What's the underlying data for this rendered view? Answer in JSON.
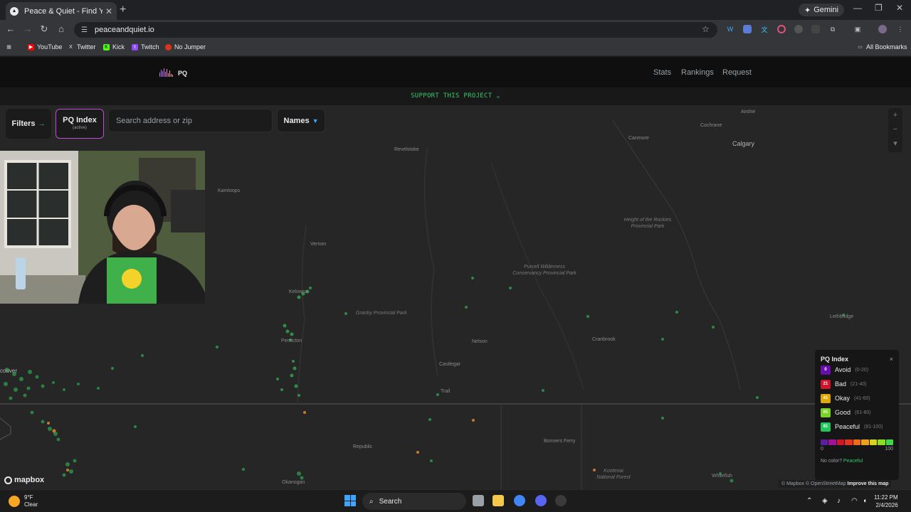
{
  "browser": {
    "tab_title": "Peace & Quiet - Find Your Quie",
    "url": "peaceandquiet.io",
    "gemini_label": "Gemini",
    "bookmarks": [
      "YouTube",
      "Twitter",
      "Kick",
      "Twitch",
      "No Jumper"
    ],
    "all_bookmarks": "All Bookmarks"
  },
  "site": {
    "logo_text": "PQ",
    "nav": [
      "Stats",
      "Rankings",
      "Request"
    ],
    "support_banner": "SUPPORT THIS PROJECT ⌄"
  },
  "controls": {
    "filters_label": "Filters",
    "pq_index_label": "PQ Index",
    "pq_index_sub": "(active)",
    "search_placeholder": "Search address or zip",
    "names_label": "Names"
  },
  "map_labels": {
    "revelstoke": "Revelstoke",
    "kamloops": "Kamloops",
    "vernon": "Vernon",
    "kelowna": "Kelowna",
    "penticton": "Penticton",
    "nelson": "Nelson",
    "castlegar": "Castlegar",
    "trail": "Trail",
    "cranbrook": "Cranbrook",
    "calgary": "Calgary",
    "airdrie": "Airdrie",
    "cochrane": "Cochrane",
    "canmore": "Canmore",
    "lethbridge": "Lethbridge",
    "granby": "Granby Provincial Park",
    "purcell": "Purcell Wilderness Conservancy Provincial Park",
    "height_rockies": "Height of the Rockies Provincial Park",
    "republic": "Republic",
    "bonners_ferry": "Bonners Ferry",
    "kootenai": "Kootenai National Forest",
    "okanogan": "Okanogan",
    "whitefish": "Whitefish",
    "vancouver": "couver"
  },
  "legend": {
    "title": "PQ Index",
    "close": "×",
    "items": [
      {
        "score": "0",
        "name": "Avoid",
        "range": "(0-20)",
        "color": "#6a0dad"
      },
      {
        "score": "21",
        "name": "Bad",
        "range": "(21-40)",
        "color": "#d0142c"
      },
      {
        "score": "41",
        "name": "Okay",
        "range": "(41-60)",
        "color": "#e0a800"
      },
      {
        "score": "61",
        "name": "Good",
        "range": "(61-80)",
        "color": "#7bd321"
      },
      {
        "score": "81",
        "name": "Peaceful",
        "range": "(81-100)",
        "color": "#22c55e"
      }
    ],
    "scale_min": "0",
    "scale_max": "100",
    "gradient": [
      "#5b1fa0",
      "#a1129a",
      "#d0142c",
      "#e0351f",
      "#ee6a16",
      "#eca31a",
      "#d6d320",
      "#8bdc24",
      "#3fd64a"
    ],
    "no_color_label": "No color?",
    "no_color_value": "Peaceful"
  },
  "map_footer": {
    "mapbox": "mapbox",
    "attribution": "© Mapbox © OpenStreetMap",
    "improve": "Improve this map"
  },
  "taskbar": {
    "temp": "9°F",
    "condition": "Clear",
    "search": "Search",
    "time": "11:22 PM",
    "date": "2/4/2026"
  }
}
